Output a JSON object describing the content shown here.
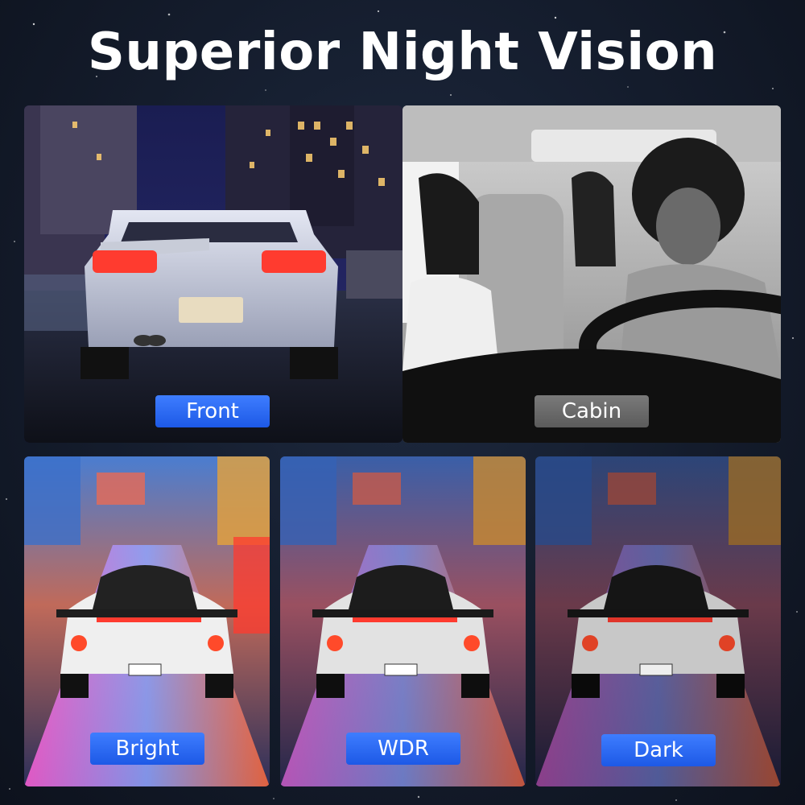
{
  "title": "Superior Night Vision",
  "panels": {
    "front": {
      "label": "Front",
      "label_color": "#2f6df5"
    },
    "cabin": {
      "label": "Cabin",
      "label_color": "#6b6b6b"
    },
    "bright": {
      "label": "Bright",
      "label_color": "#2f6df5"
    },
    "wdr": {
      "label": "WDR",
      "label_color": "#2f6df5"
    },
    "dark": {
      "label": "Dark",
      "label_color": "#2f6df5"
    }
  },
  "colors": {
    "background": "#161e2e",
    "accent_blue": "#2f6df5",
    "tail_light": "#ff3b2f"
  }
}
